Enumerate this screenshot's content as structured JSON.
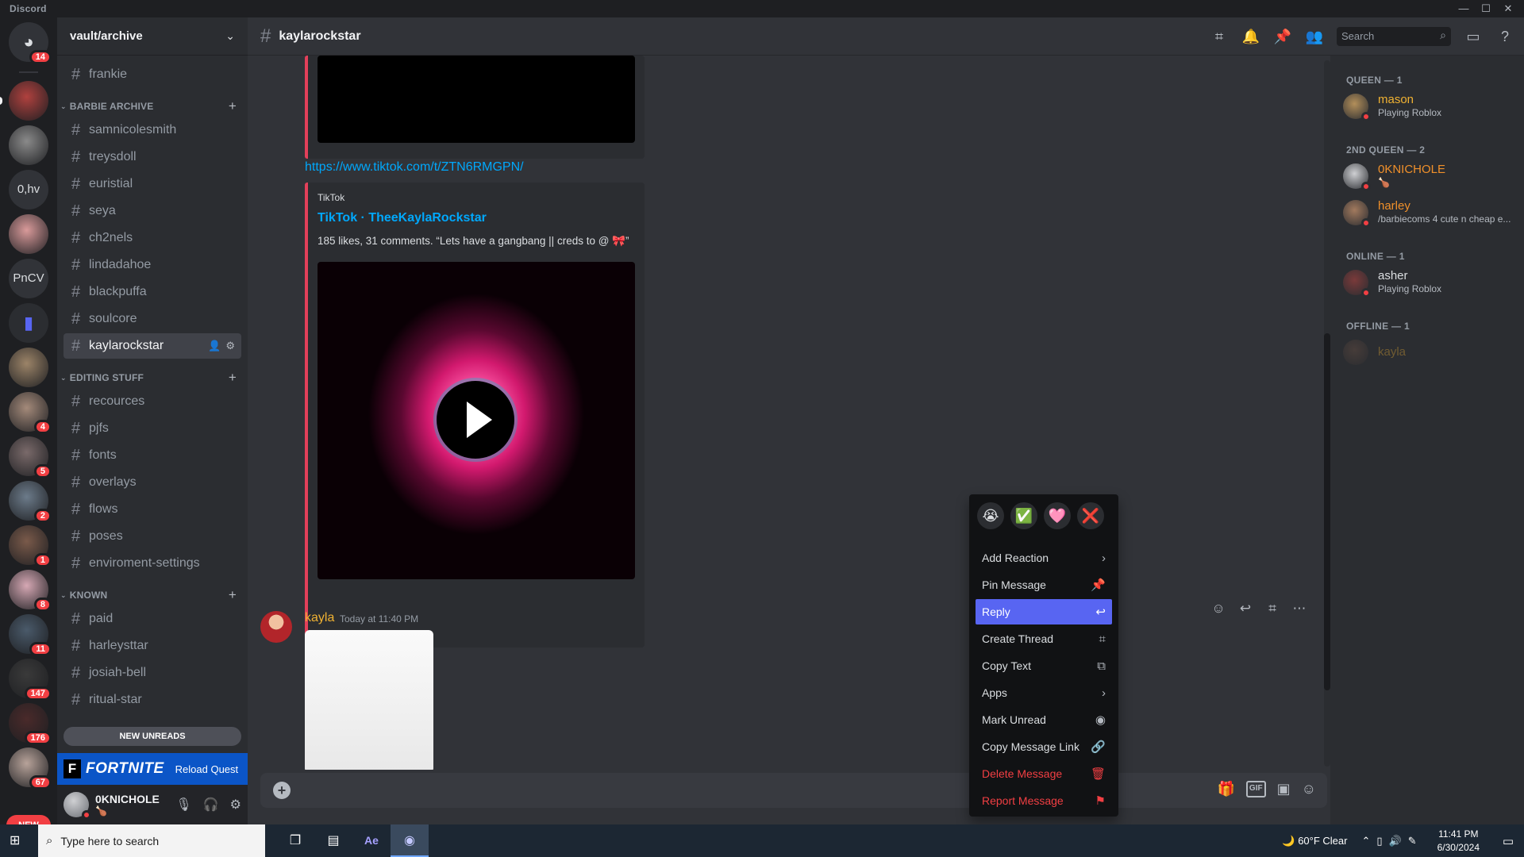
{
  "window": {
    "title": "Discord",
    "controls": [
      "—",
      "☐",
      "✕"
    ]
  },
  "servers": [
    {
      "kind": "home",
      "badge": "14",
      "color": "#5865f2"
    },
    {
      "kind": "avatar",
      "badge": "",
      "color": "#b0413e",
      "pip": true
    },
    {
      "kind": "avatar",
      "badge": "",
      "color": "#8a8a8a"
    },
    {
      "kind": "text",
      "text": "0,hv"
    },
    {
      "kind": "avatar",
      "badge": "",
      "color": "#d99a9a"
    },
    {
      "kind": "text",
      "text": "PnCV"
    },
    {
      "kind": "folder",
      "color": "#5865f2"
    },
    {
      "kind": "avatar",
      "badge": "",
      "color": "#9c8468"
    },
    {
      "kind": "avatar",
      "badge": "4",
      "color": "#a48a7a"
    },
    {
      "kind": "avatar",
      "badge": "5",
      "color": "#7a6a6a"
    },
    {
      "kind": "avatar",
      "badge": "2",
      "color": "#6c7b8a"
    },
    {
      "kind": "avatar",
      "badge": "1",
      "color": "#7a5a4a"
    },
    {
      "kind": "avatar",
      "badge": "8",
      "color": "#d6a8b4"
    },
    {
      "kind": "avatar",
      "badge": "11",
      "color": "#4a5a6a"
    },
    {
      "kind": "avatar",
      "badge": "147",
      "color": "#3a3a3a"
    },
    {
      "kind": "avatar",
      "badge": "176",
      "color": "#4a2a2a"
    },
    {
      "kind": "avatar",
      "badge": "67",
      "color": "#b8a39a"
    }
  ],
  "rail": {
    "new_label": "NEW"
  },
  "guild": {
    "name": "vault/archive",
    "chevron": "⌄"
  },
  "channels": {
    "top": [
      {
        "name": "frankie"
      }
    ],
    "categories": [
      {
        "name": "BARBIE ARCHIVE",
        "channels": [
          "samnicolesmith",
          "treysdoll",
          "euristial",
          "seya",
          "ch2nels",
          "lindadahoe",
          "blackpuffa",
          "soulcore",
          "kaylarockstar"
        ]
      },
      {
        "name": "EDITING STUFF",
        "channels": [
          "recources",
          "pjfs",
          "fonts",
          "overlays",
          "flows",
          "poses",
          "enviroment-settings"
        ]
      },
      {
        "name": "KNOWN",
        "channels": [
          "paid",
          "harleysttar",
          "josiah-bell",
          "ritual-star"
        ]
      }
    ],
    "active": "kaylarockstar"
  },
  "new_unreads": "NEW UNREADS",
  "quest": {
    "logo": "F",
    "title": "FORTNITE",
    "action": "Reload Quest"
  },
  "user_panel": {
    "name": "0KNICHOLE",
    "status": "🍗"
  },
  "header": {
    "channel": "kaylarockstar",
    "search_placeholder": "Search"
  },
  "embed": {
    "link": "https://www.tiktok.com/t/ZTN6RMGPN/",
    "provider": "TikTok",
    "title": "TikTok · TheeKaylaRockstar",
    "description": "185 likes, 31 comments. “Lets have a gangbang || creds to @ 🎀”"
  },
  "message": {
    "author": "kayla",
    "timestamp": "Today at 11:40 PM"
  },
  "context_menu": {
    "quick_reactions": [
      "😭",
      "✅",
      "🩷",
      "❌"
    ],
    "items": [
      {
        "label": "Add Reaction",
        "icon": "›"
      },
      {
        "label": "Pin Message",
        "icon": "📌"
      },
      {
        "label": "Reply",
        "icon": "↩"
      },
      {
        "label": "Create Thread",
        "icon": "⌗"
      },
      {
        "label": "Copy Text",
        "icon": "⧉"
      },
      {
        "label": "Apps",
        "icon": "›"
      },
      {
        "label": "Mark Unread",
        "icon": "◉"
      },
      {
        "label": "Copy Message Link",
        "icon": "🔗"
      },
      {
        "label": "Delete Message",
        "icon": "🗑"
      },
      {
        "label": "Report Message",
        "icon": "⚑"
      }
    ]
  },
  "members": {
    "groups": [
      {
        "label": "QUEEN — 1",
        "members": [
          {
            "name": "mason",
            "sub": "Playing Roblox",
            "color": "#f0b232"
          }
        ]
      },
      {
        "label": "2ND QUEEN — 2",
        "members": [
          {
            "name": "0KNICHOLE",
            "sub": "🍗",
            "color": "#f0902a"
          },
          {
            "name": "harley",
            "sub": "/barbiecoms 4 cute n cheap e...",
            "color": "#f0902a"
          }
        ]
      },
      {
        "label": "ONLINE — 1",
        "members": [
          {
            "name": "asher",
            "sub": "Playing Roblox",
            "color": "#dbdee1"
          }
        ]
      },
      {
        "label": "OFFLINE — 1",
        "members": [
          {
            "name": "kayla",
            "sub": "",
            "color": "#f0b232"
          }
        ]
      }
    ]
  },
  "taskbar": {
    "search_placeholder": "Type here to search",
    "weather": "60°F  Clear",
    "time": "11:41 PM",
    "date": "6/30/2024"
  }
}
